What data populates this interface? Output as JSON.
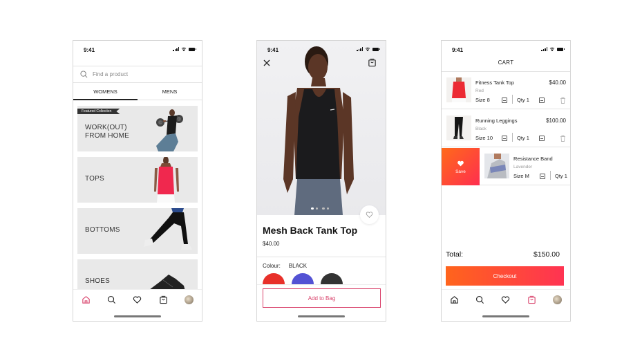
{
  "status_bar": {
    "time": "9:41"
  },
  "home_screen": {
    "search": {
      "placeholder": "Find a product",
      "value": ""
    },
    "tabs": [
      {
        "label": "WOMENS",
        "active": true
      },
      {
        "label": "MENS",
        "active": false
      }
    ],
    "categories": [
      {
        "label": "WORK(OUT)\nFROM HOME",
        "badge": "Featured Collection"
      },
      {
        "label": "TOPS"
      },
      {
        "label": "BOTTOMS"
      },
      {
        "label": "SHOES"
      }
    ],
    "nav": {
      "active": "home"
    }
  },
  "product_screen": {
    "title": "Mesh Back Tank Top",
    "price": "$40.00",
    "carousel": {
      "count": 4,
      "active_index": 0
    },
    "colour_label": "Colour:",
    "colour_value": "BLACK",
    "swatches": [
      "#e8302a",
      "#5352d4",
      "#333333"
    ],
    "add_to_bag_label": "Add to Bag",
    "accent": "#d9426b"
  },
  "cart_screen": {
    "title": "CART",
    "items": [
      {
        "name": "Fitness Tank Top",
        "color": "Red",
        "size": "Size 8",
        "qty": "Qty 1",
        "price": "$40.00"
      },
      {
        "name": "Running Leggings",
        "color": "Black",
        "size": "Size 10",
        "qty": "Qty 1",
        "price": "$100.00"
      },
      {
        "name": "Resistance Band",
        "color": "Lavender",
        "size": "Size M",
        "qty": "Qty 1",
        "price": ""
      }
    ],
    "swipe_action_label": "Save",
    "total_label": "Total:",
    "total_value": "$150.00",
    "checkout_label": "Checkout",
    "nav": {
      "active": "bag"
    }
  },
  "colors": {
    "accent_pink": "#d9426b",
    "gradient_start": "#ff641c",
    "gradient_end": "#ff3352"
  }
}
